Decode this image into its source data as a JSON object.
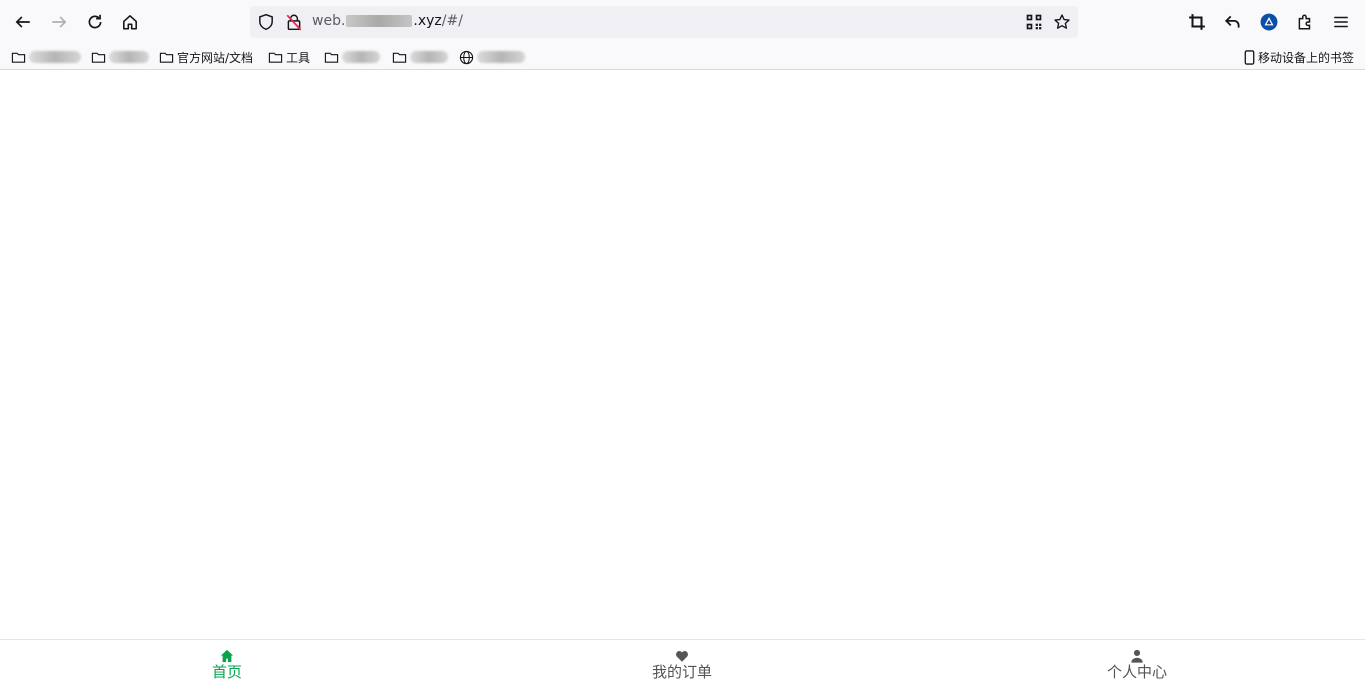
{
  "browser": {
    "url": {
      "prefix": "web.",
      "suffix": ".xyz",
      "path": "/#/"
    },
    "bookmarks": {
      "official": "官方网站/文档",
      "tools": "工具",
      "mobile": "移动设备上的书签"
    }
  },
  "tabbar": {
    "active_color": "#07a44b",
    "items": [
      {
        "label": "首页",
        "icon": "home-icon",
        "active": true
      },
      {
        "label": "我的订单",
        "icon": "heart-icon",
        "active": false
      },
      {
        "label": "个人中心",
        "icon": "user-icon",
        "active": false
      }
    ]
  }
}
